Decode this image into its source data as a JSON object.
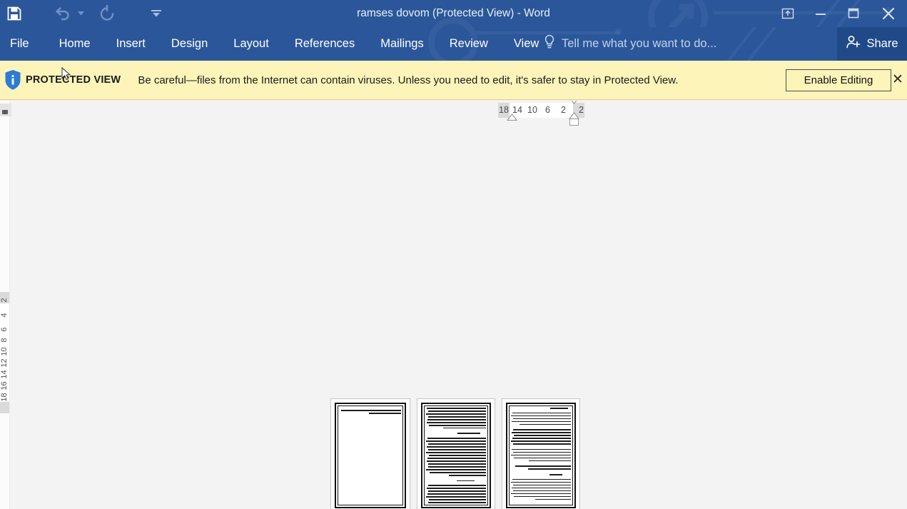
{
  "window": {
    "title": "ramses dovom (Protected View) - Word",
    "accent_color": "#2b579a",
    "share_button_color": "#204a87",
    "controls": [
      {
        "name": "ribbon-display-options",
        "glyph": "ribbon"
      },
      {
        "name": "minimize",
        "glyph": "minimize"
      },
      {
        "name": "maximize",
        "glyph": "maximize"
      },
      {
        "name": "close",
        "glyph": "close"
      }
    ]
  },
  "quick_access": {
    "save_label": "Save",
    "undo_label": "Undo",
    "redo_label": "Repeat",
    "customize_label": "Customize Quick Access Toolbar"
  },
  "ribbon": {
    "tabs": [
      {
        "label": "File"
      },
      {
        "label": "Home"
      },
      {
        "label": "Insert"
      },
      {
        "label": "Design"
      },
      {
        "label": "Layout"
      },
      {
        "label": "References"
      },
      {
        "label": "Mailings"
      },
      {
        "label": "Review"
      },
      {
        "label": "View"
      }
    ],
    "tell_me_placeholder": "Tell me what you want to do...",
    "share_label": "Share"
  },
  "protected_view": {
    "badge": "PROTECTED VIEW",
    "message": "Be careful—files from the Internet can contain viruses. Unless you need to edit, it's safer to stay in Protected View.",
    "enable_button": "Enable Editing",
    "close_label": "✕",
    "background_color": "#fdf4ba",
    "icon_name": "shield-info-icon"
  },
  "horizontal_ruler": {
    "ticks": [
      "18",
      "14",
      "10",
      "6",
      "2",
      "2"
    ]
  },
  "vertical_ruler": {
    "ticks": [
      "2",
      "4",
      "6",
      "8",
      "10",
      "12",
      "14",
      "16",
      "18"
    ]
  },
  "document": {
    "zoom_state": "multi-page-thumbnail",
    "page_count": 3,
    "pages": [
      {
        "number": "1",
        "content": "two-line-heading-only"
      },
      {
        "number": "2",
        "content": "dense-text-three-sections"
      },
      {
        "number": "3",
        "content": "dense-text-four-sections"
      }
    ]
  },
  "canvas": {
    "background_color": "#f3f3f3"
  }
}
